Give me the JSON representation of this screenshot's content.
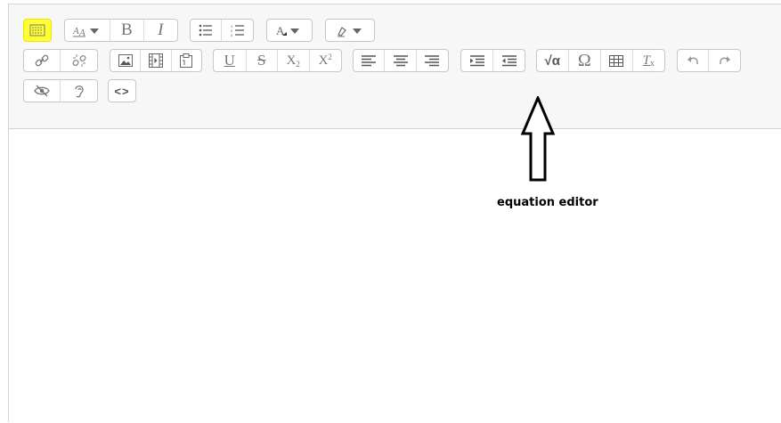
{
  "toolbar": {
    "toggle": {
      "icon": "toolbar-toggle-icon",
      "highlight": "#ffff33"
    },
    "font": {
      "style_icon": "font-style-icon"
    },
    "format": {
      "bold": "B",
      "italic": "I"
    },
    "lists": [
      "bullet-list-icon",
      "numbered-list-icon"
    ],
    "text_color": {
      "icon": "text-color-icon"
    },
    "background_color": {
      "icon": "highlighter-icon"
    },
    "links": [
      "link-icon",
      "unlink-icon"
    ],
    "media": [
      "image-icon",
      "media-icon",
      "manage-files-icon"
    ],
    "styles": {
      "underline": "U",
      "strike": "S",
      "subscript": "X",
      "sub_mark": "2",
      "superscript": "X",
      "sup_mark": "2"
    },
    "align": [
      "align-left-icon",
      "align-center-icon",
      "align-right-icon"
    ],
    "indent": [
      "indent-icon",
      "outdent-icon"
    ],
    "insert": {
      "equation": "√α",
      "special_char": "Ω",
      "clear_format": "T",
      "clear_mark": "x"
    },
    "history": [
      "undo-icon",
      "redo-icon"
    ],
    "access": [
      "accessibility-checker-icon",
      "screen-reader-icon"
    ],
    "html": {
      "label": "<>"
    }
  },
  "annotation": {
    "caption": "equation editor"
  }
}
